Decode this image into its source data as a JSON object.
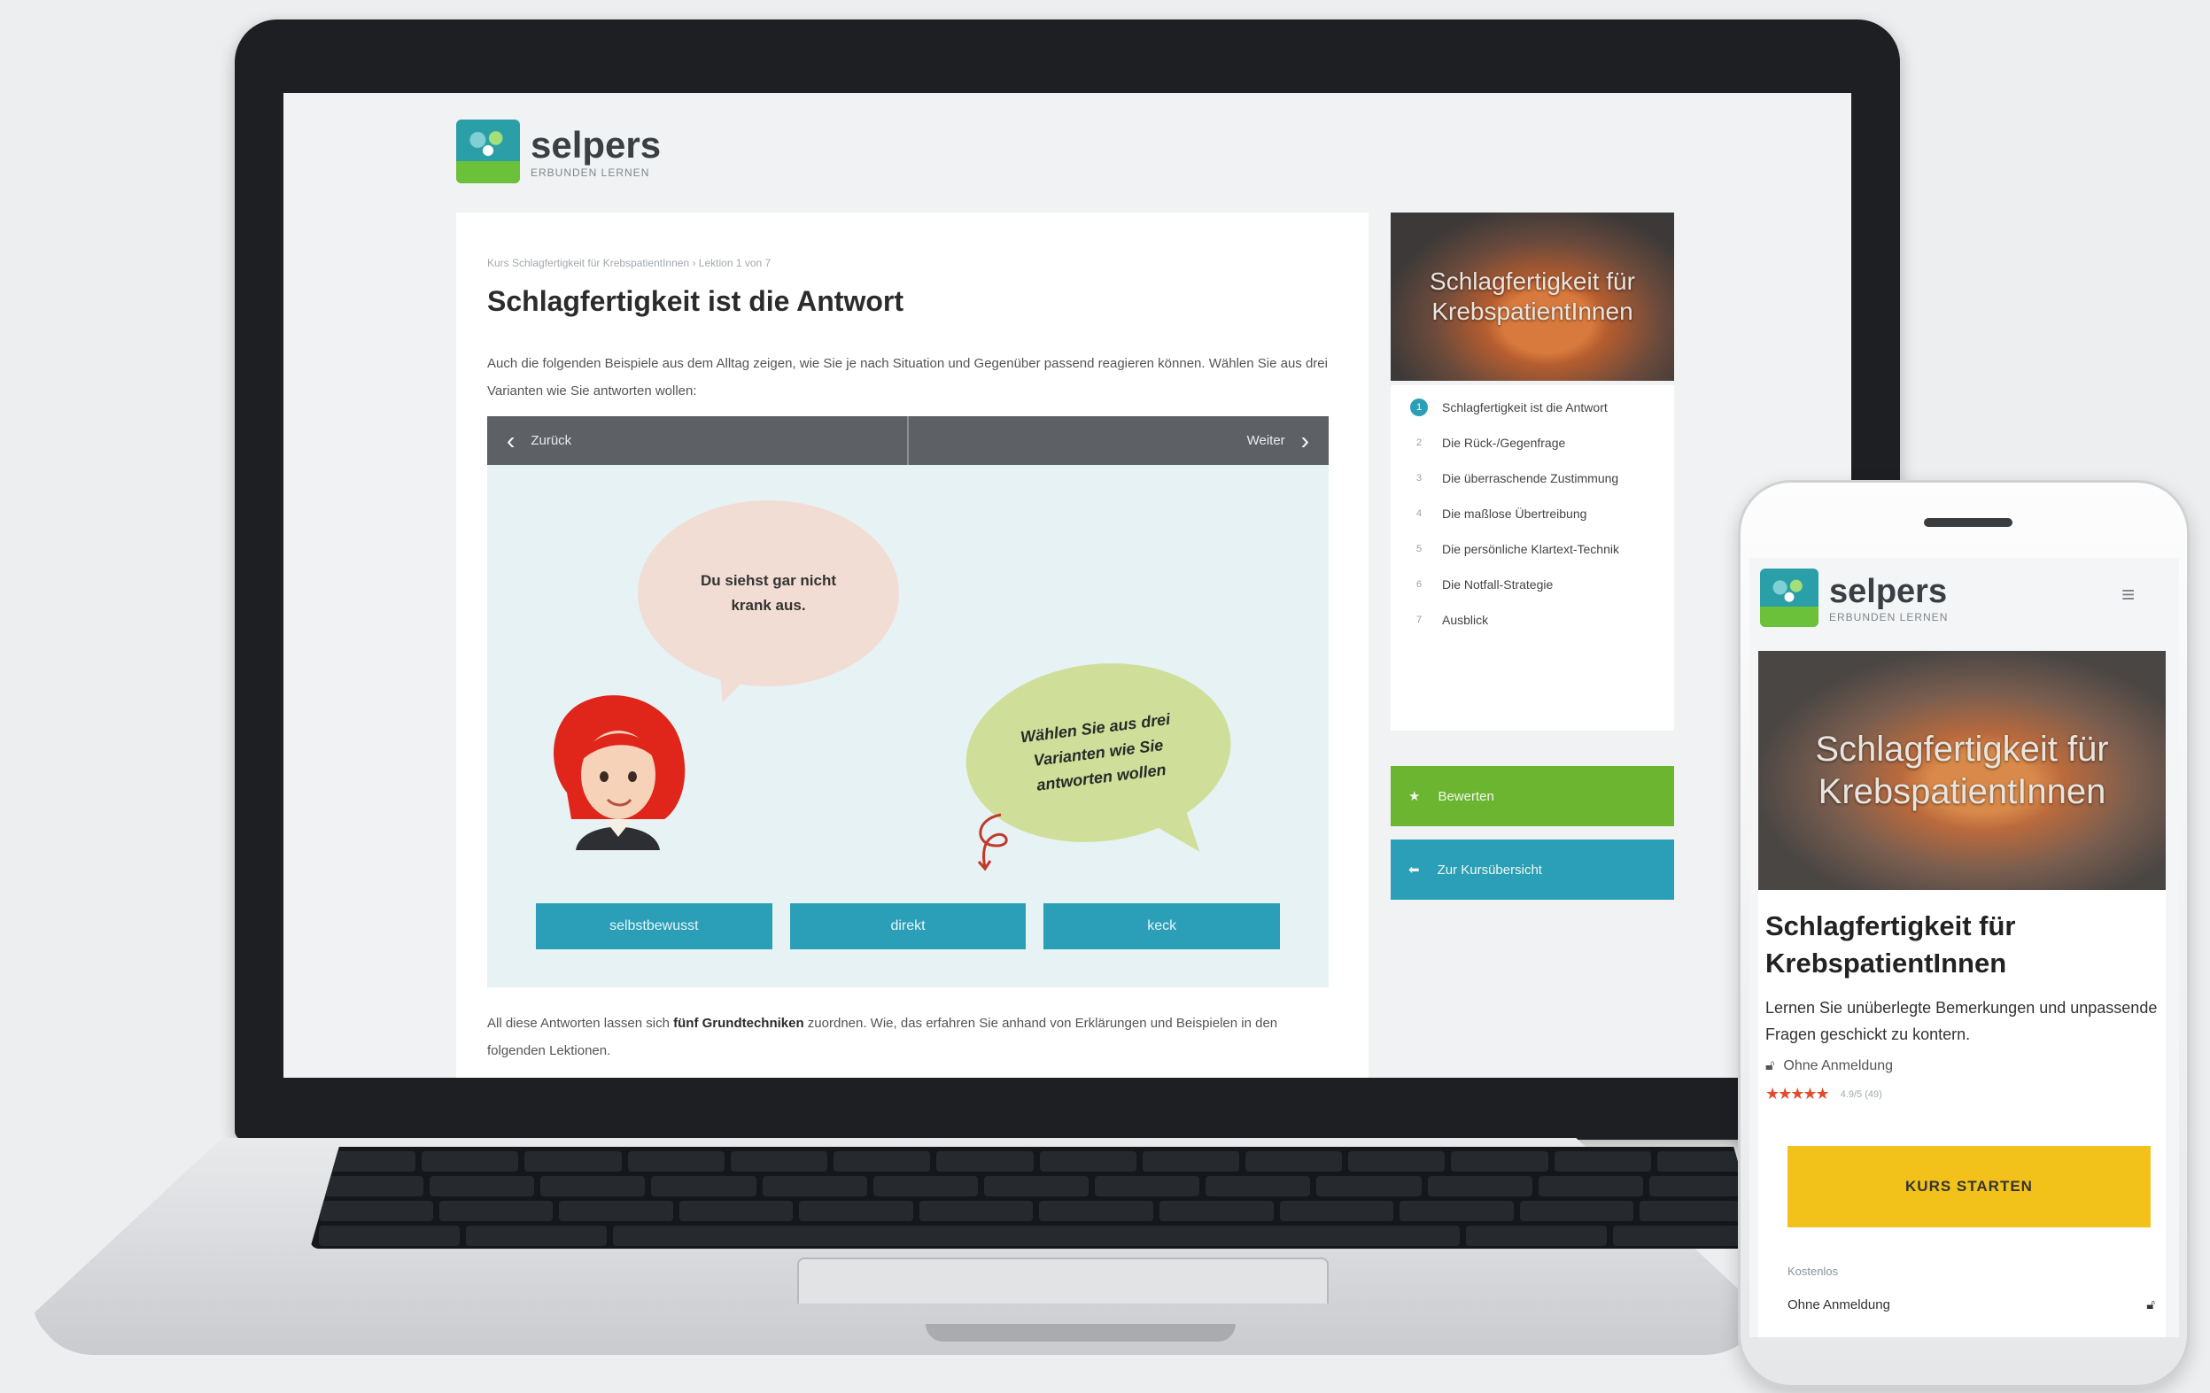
{
  "brand": {
    "name": "selpers",
    "tagline": "ERBUNDEN LERNEN"
  },
  "lesson": {
    "breadcrumb": "Kurs Schlagfertigkeit für KrebspatientInnen › Lektion 1 von 7",
    "title": "Schlagfertigkeit ist die Antwort",
    "intro": "Auch die folgenden Beispiele aus dem Alltag zeigen, wie Sie je nach Situation und Gegenüber passend reagieren können. Wählen Sie aus drei Varianten wie Sie antworten wollen:",
    "nav": {
      "back_label": "Zurück",
      "next_label": "Weiter"
    },
    "scene": {
      "bubble_statement": "Du siehst gar nicht krank aus.",
      "bubble_prompt": "Wählen Sie aus drei Varianten wie Sie antworten wollen"
    },
    "choices": [
      "selbstbewusst",
      "direkt",
      "keck"
    ],
    "outro_prefix": "All diese Antworten lassen sich",
    "outro_bold": "fünf Grundtechniken",
    "outro_suffix": "zuordnen. Wie, das erfahren Sie anhand von Erklärungen und Beispielen in den folgenden Lektionen."
  },
  "sidebar": {
    "course_thumb_title": "Schlagfertigkeit für KrebspatientInnen",
    "toc": [
      {
        "num": "1",
        "label": "Schlagfertigkeit ist die Antwort"
      },
      {
        "num": "2",
        "label": "Die Rück-/Gegenfrage"
      },
      {
        "num": "3",
        "label": "Die überraschende Zustimmung"
      },
      {
        "num": "4",
        "label": "Die maßlose Übertreibung"
      },
      {
        "num": "5",
        "label": "Die persönliche Klartext-Technik"
      },
      {
        "num": "6",
        "label": "Die Notfall-Strategie"
      },
      {
        "num": "7",
        "label": "Ausblick"
      }
    ],
    "rate_label": "Bewerten",
    "overview_label": "Zur Kursübersicht"
  },
  "phone": {
    "hero_title": "Schlagfertigkeit für KrebspatientInnen",
    "course_title": "Schlagfertigkeit für KrebspatientInnen",
    "description": "Lernen Sie unüberlegte Bemerkungen und unpassende Fragen geschickt zu kontern.",
    "access": "Ohne Anmeldung",
    "stars": "★★★★★",
    "reviews": "4.9/5 (49)",
    "cta_label": "KURS STARTEN",
    "price_label": "Kostenlos",
    "price_value": "Ohne Anmeldung"
  },
  "colors": {
    "accent_teal": "#2a9fb7",
    "accent_green": "#6cb530",
    "cta_yellow": "#f2c21a",
    "star_red": "#e24b2e"
  }
}
